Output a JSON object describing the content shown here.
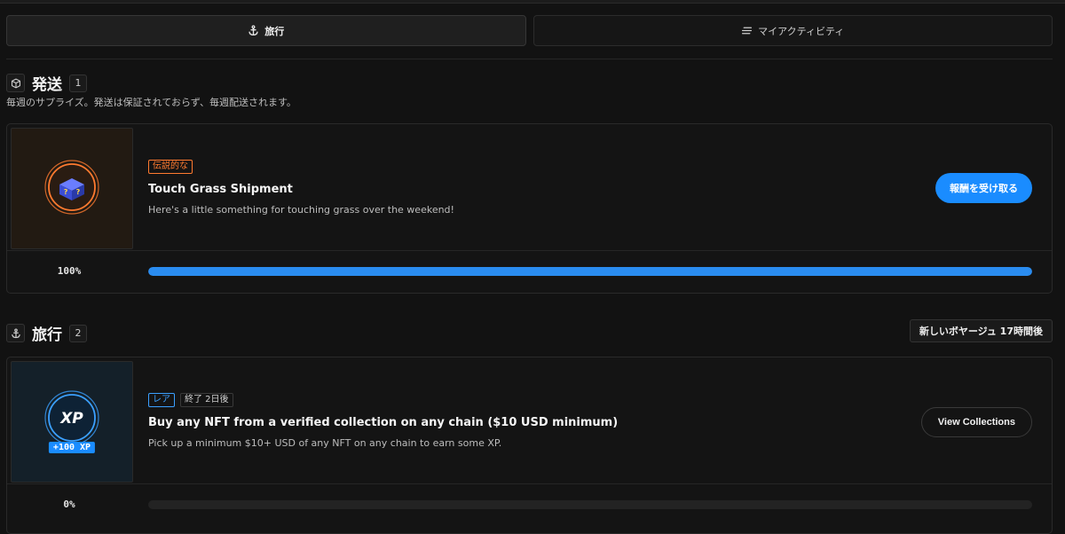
{
  "tabs": [
    {
      "label": "旅行",
      "icon": "anchor-icon",
      "active": true
    },
    {
      "label": "マイアクティビティ",
      "icon": "list-icon",
      "active": false
    }
  ],
  "shipments": {
    "title": "発送",
    "count": "1",
    "description": "毎週のサプライズ。発送は保証されておらず、毎週配送されます。",
    "card": {
      "rarity": "伝説的な",
      "title": "Touch Grass Shipment",
      "description": "Here's a little something for touching grass over the weekend!",
      "button": "報酬を受け取る",
      "progress_label": "100%",
      "progress": 1.0,
      "icon": "mystery-crate-icon"
    }
  },
  "voyages": {
    "title": "旅行",
    "count": "2",
    "new_voyage": "新しいボヤージュ 17時間後",
    "card": {
      "rarity": "レア",
      "ends": "終了 2日後",
      "title": "Buy any NFT from a verified collection on any chain ($10 USD minimum)",
      "description": "Pick up a minimum $10+ USD of any NFT on any chain to earn some XP.",
      "button": "View Collections",
      "xp_logo": "XP",
      "xp_reward": "+100 XP",
      "progress_label": "0%",
      "progress": 0
    }
  },
  "colors": {
    "accent": "#1a8cff",
    "legendary": "#ff7a2f",
    "rare": "#3ba0ff",
    "background": "#121212"
  }
}
